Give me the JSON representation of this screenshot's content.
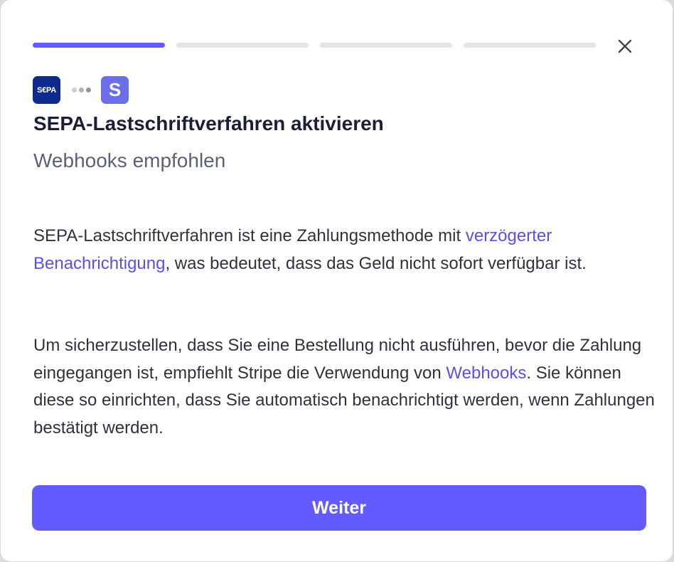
{
  "progress": {
    "steps": 4,
    "current": 1
  },
  "logos": {
    "sepa_text": "S€PA",
    "stripe_text": "S"
  },
  "header": {
    "title": "SEPA-Lastschriftverfahren aktivieren",
    "subtitle": "Webhooks empfohlen"
  },
  "body": {
    "p1_before": "SEPA-Lastschriftverfahren ist eine Zahlungsmethode mit ",
    "p1_link": "verzögerter Benachrichtigung",
    "p1_after": ", was bedeutet, dass das Geld nicht sofort verfügbar ist.",
    "p2_before": "Um sicherzustellen, dass Sie eine Bestellung nicht ausführen, bevor die Zahlung eingegangen ist, empfiehlt Stripe die Verwendung von ",
    "p2_link": "Webhooks",
    "p2_after": ". Sie können diese so einrichten, dass Sie automatisch benachrichtigt werden, wenn Zahlungen bestätigt werden."
  },
  "footer": {
    "continue_label": "Weiter"
  },
  "colors": {
    "accent": "#635bff",
    "link": "#5850ec",
    "sepa_blue": "#10298e"
  },
  "icons": {
    "close": "close-icon"
  }
}
